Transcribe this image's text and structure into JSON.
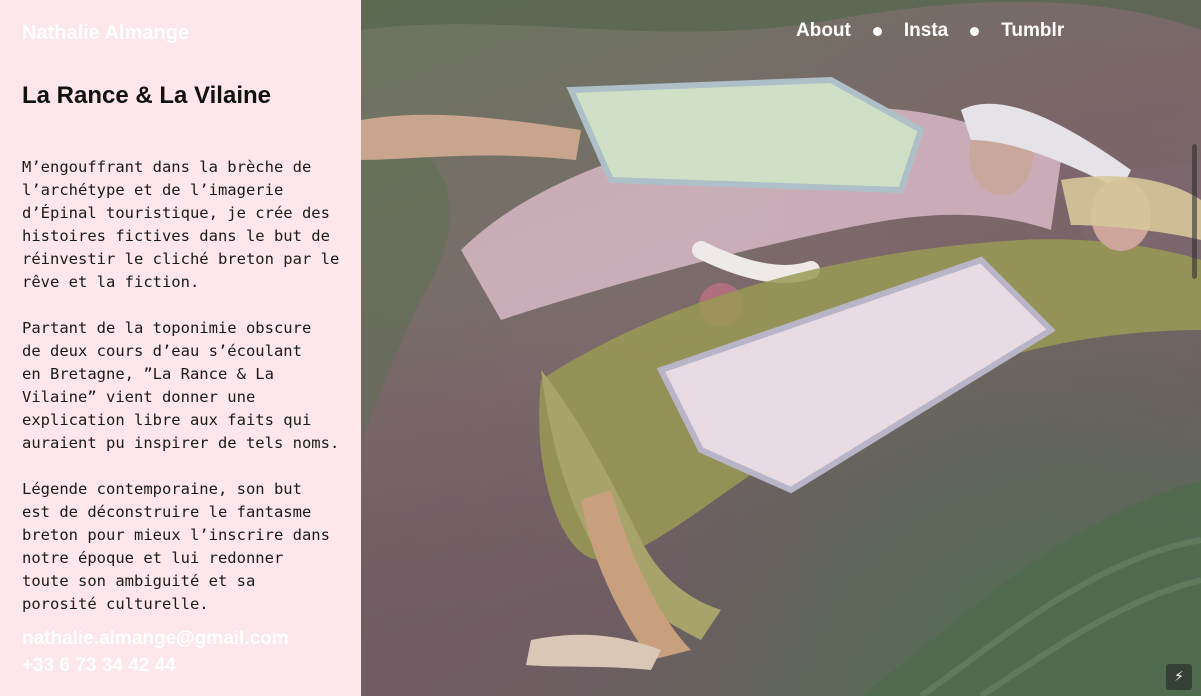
{
  "site": {
    "name": "Nathalie Almange"
  },
  "nav": {
    "items": [
      {
        "label": "About"
      },
      {
        "label": "Insta"
      },
      {
        "label": "Tumblr"
      }
    ]
  },
  "project": {
    "title": "La Rance & La Vilaine",
    "paragraphs": [
      "M’engouffrant dans la brèche de\nl’archétype et de l’imagerie\nd’Épinal touristique, je crée des\nhistoires fictives dans le but de\nréinvestir le cliché breton par le\nrêve et la fiction.",
      "Partant de la toponimie obscure\nde deux cours d’eau s’écoulant\nen Bretagne, ”La Rance & La\nVilaine” vient donner une\nexplication libre aux faits qui\nauraient pu inspirer de tels noms.",
      "Légende contemporaine, son but\nest de déconstruire le fantasme\nbreton pour mieux l’inscrire dans\nnotre époque et lui redonner\ntoute son ambiguité et sa\nporosité culturelle."
    ]
  },
  "contact": {
    "email": "nathalie.almange@gmail.com",
    "phone": "+33 6 73 34 42 44"
  },
  "badge": {
    "icon": "lightning-icon",
    "glyph": "⚡"
  },
  "colors": {
    "panel_bg": "#fde7ea",
    "text": "#1a1a1a",
    "contrast": "#ffffff"
  }
}
